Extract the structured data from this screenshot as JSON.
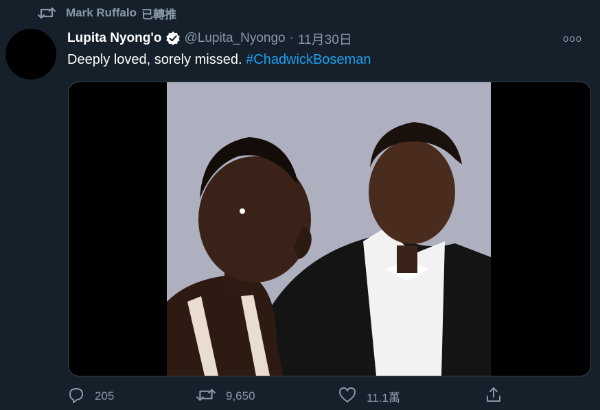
{
  "retweet": {
    "icon": "retweet-icon",
    "by": "Mark Ruffalo",
    "label": "已轉推"
  },
  "tweet": {
    "display_name": "Lupita Nyong'o",
    "verified": true,
    "handle": "@Lupita_Nyongo",
    "separator": "·",
    "date": "11月30日",
    "more_icon": "more-icon",
    "more_label": "ooo",
    "text": "Deeply loved, sorely missed.",
    "hashtag": "#ChadwickBoseman"
  },
  "actions": {
    "reply_count": "205",
    "retweet_count": "9,650",
    "like_count": "11.1萬"
  },
  "colors": {
    "background": "#15202b",
    "muted": "#8899a6",
    "link": "#1da1f2",
    "verified_badge": "#ffffff"
  }
}
